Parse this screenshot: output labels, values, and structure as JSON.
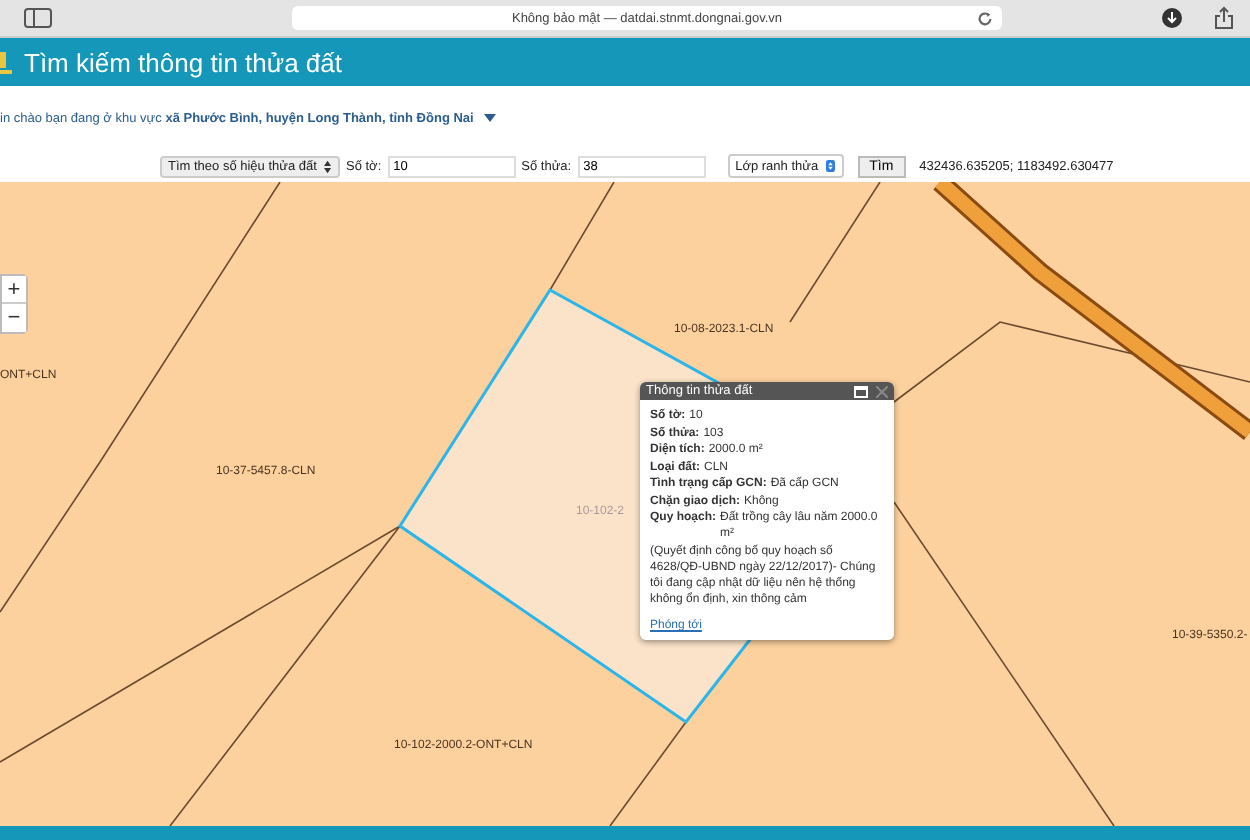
{
  "browser": {
    "address": "Không bảo mật — datdai.stnmt.dongnai.gov.vn"
  },
  "header": {
    "title": "Tìm kiếm thông tin thửa đất"
  },
  "welcome": "in chào bạn đang ở khu vực **xã Phước Bình, huyện Long Thành, tỉnh Đồng Nai**",
  "search": {
    "mode": "Tìm theo số hiệu thửa đất",
    "sheet_label": "Số tờ:",
    "sheet_value": "10",
    "parcel_label": "Số thửa:",
    "parcel_value": "38",
    "layer": "Lớp ranh thửa",
    "button": "Tìm",
    "coordinates": "432436.635205; 1183492.630477"
  },
  "map": {
    "zoom_in": "+",
    "zoom_out": "−",
    "labels": [
      {
        "text": "10-08-2023.1-CLN",
        "kind": "normal"
      },
      {
        "text": "ONT+CLN",
        "kind": "normal"
      },
      {
        "text": "10-37-5457.8-CLN",
        "kind": "normal"
      },
      {
        "text": "10-102-2",
        "kind": "faded"
      },
      {
        "text": "10-102-2000.2-ONT+CLN",
        "kind": "normal"
      },
      {
        "text": "10-39-5350.2-",
        "kind": "normal"
      }
    ]
  },
  "popup": {
    "title": "Thông tin thửa đất",
    "fields": [
      {
        "label": "Số tờ:",
        "value": "10"
      },
      {
        "label": "Số thửa:",
        "value": "103"
      },
      {
        "label": "Diện tích:",
        "value": "2000.0 m²"
      },
      {
        "label": "Loại đất:",
        "value": "CLN"
      },
      {
        "label": "Tình trạng cấp GCN:",
        "value": "Đã cấp GCN"
      },
      {
        "label": "Chặn giao dịch:",
        "value": "Không"
      },
      {
        "label": "Quy hoạch:",
        "value": "Đất trồng cây lâu năm 2000.0 m²"
      }
    ],
    "note": "(Quyết định công bố quy hoạch số 4628/QĐ-UBND ngày 22/12/2017)- Chúng tôi đang cập nhật dữ liệu nên hệ thống không ổn định, xin thông cảm",
    "link": "Phóng tới"
  }
}
